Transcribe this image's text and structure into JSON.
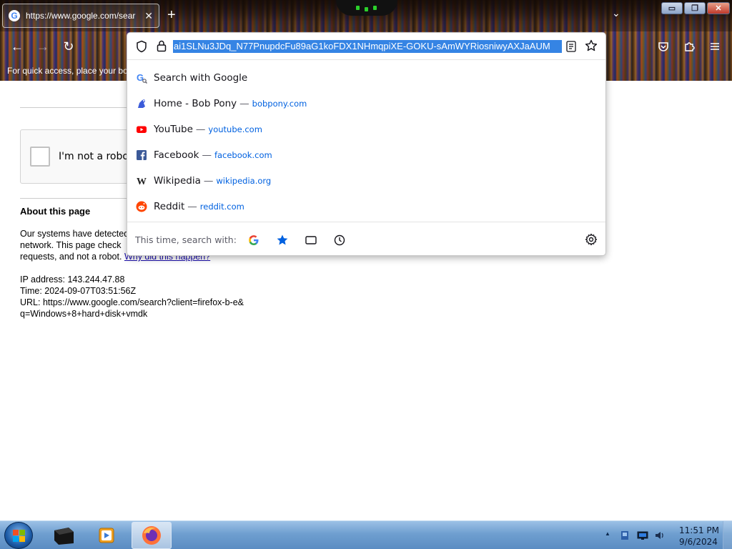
{
  "browser": {
    "tab": {
      "favicon": "G",
      "title": "https://www.google.com/sear",
      "close": "✕"
    },
    "new_tab": "+",
    "tab_list": "⌄",
    "window_buttons": {
      "minimize": "▭",
      "restore": "❐",
      "close": "✕"
    },
    "nav": {
      "back": "←",
      "forward": "→",
      "reload": "↻"
    },
    "bookmark_hint": "For quick access, place your boo",
    "accent": "#3584e4"
  },
  "urlbar": {
    "value": "ai1SLNu3JDq_N77PnupdcFu89aG1koFDX1NHmqpiXE-GOKU-sAmWYRiosniwyAXJaAUM",
    "suggestions": [
      {
        "icon": "google-search-icon",
        "title": "Search with Google",
        "sep": "",
        "url": ""
      },
      {
        "icon": "bobpony-icon",
        "title": "Home - Bob Pony",
        "sep": "—",
        "url": "bobpony.com"
      },
      {
        "icon": "youtube-icon",
        "title": "YouTube",
        "sep": "—",
        "url": "youtube.com"
      },
      {
        "icon": "facebook-icon",
        "title": "Facebook",
        "sep": "—",
        "url": "facebook.com"
      },
      {
        "icon": "wikipedia-icon",
        "title": "Wikipedia",
        "sep": "—",
        "url": "wikipedia.org"
      },
      {
        "icon": "reddit-icon",
        "title": "Reddit",
        "sep": "—",
        "url": "reddit.com"
      }
    ],
    "oneoff_label": "This time, search with:"
  },
  "page": {
    "captcha_label": "I'm not a robot",
    "about_title": "About this page",
    "para_line1": "Our systems have detected",
    "para_line2": "network. This page check",
    "para_line3_text": "requests, and not a robot.",
    "why_link": "Why did this happen?",
    "ip_line": "IP address: 143.244.47.88",
    "time_line": "Time: 2024-09-07T03:51:56Z",
    "url_line1": "URL: https://www.google.com/search?client=firefox-b-e&",
    "url_line2": "q=Windows+8+hard+disk+vmdk"
  },
  "taskbar": {
    "time": "11:51 PM",
    "date": "9/6/2024"
  }
}
